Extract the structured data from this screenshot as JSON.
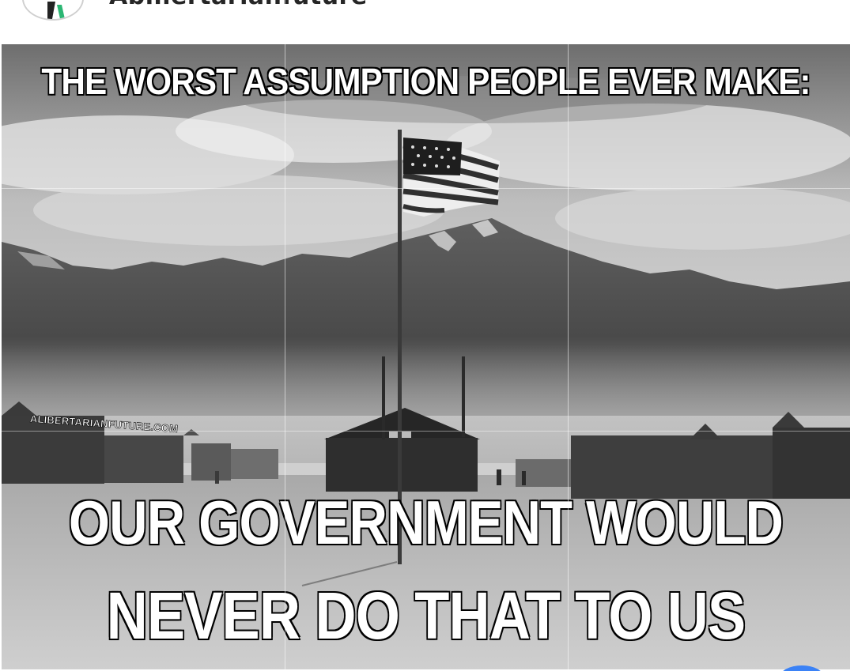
{
  "post": {
    "account_name": "Abillertarianfuture",
    "avatar_icon": "account-logo-icon"
  },
  "meme": {
    "top_caption": "THE WORST ASSUMPTION PEOPLE EVER MAKE:",
    "bottom_caption_line1": "OUR GOVERNMENT WOULD",
    "bottom_caption_line2": "NEVER DO THAT TO US",
    "watermark": "ALIBERTARIANFUTURE.COM"
  },
  "colors": {
    "caption_fill": "#ffffff",
    "caption_stroke": "#000000",
    "overlay_grid": "#ffffff",
    "accent_dot": "#3b82f6"
  }
}
